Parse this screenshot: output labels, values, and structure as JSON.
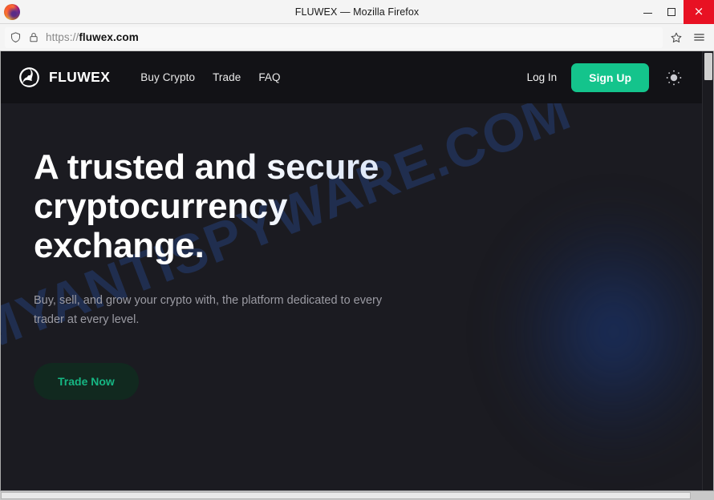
{
  "browser": {
    "window_title": "FLUWEX — Mozilla Firefox",
    "app_icon": "firefox-logo-icon",
    "controls": {
      "minimize": "minimize-icon",
      "maximize": "maximize-icon",
      "close": "×"
    },
    "urlbar": {
      "shield_icon": "tracking-protection-shield-icon",
      "lock_icon": "padlock-secure-icon",
      "url_scheme": "https://",
      "url_host": "fluwex.com",
      "full_url": "https://fluwex.com",
      "bookmark_icon": "star-bookmark-icon",
      "menu_icon": "hamburger-menu-icon"
    }
  },
  "site": {
    "navbar": {
      "logo_icon": "fluwex-swirl-logo-icon",
      "brand": "FLUWEX",
      "links": [
        {
          "label": "Buy Crypto"
        },
        {
          "label": "Trade"
        },
        {
          "label": "FAQ"
        }
      ],
      "login_label": "Log In",
      "signup_label": "Sign Up",
      "theme_toggle_icon": "sun-theme-toggle-icon"
    },
    "hero": {
      "title": "A trusted and secure cryptocurrency exchange.",
      "subtitle": "Buy, sell, and grow your crypto with, the platform dedicated to every trader at every level.",
      "cta_label": "Trade Now",
      "watermark": "MYANTISPYWARE.COM"
    }
  },
  "colors": {
    "accent_green": "#14c48c",
    "cta_green_text": "#16b683",
    "cta_green_bg": "#11291f",
    "navbar_bg": "#121216",
    "hero_bg": "#1b1b21",
    "watermark_blue": "#2f5cb9",
    "close_button_red": "#e81123"
  }
}
